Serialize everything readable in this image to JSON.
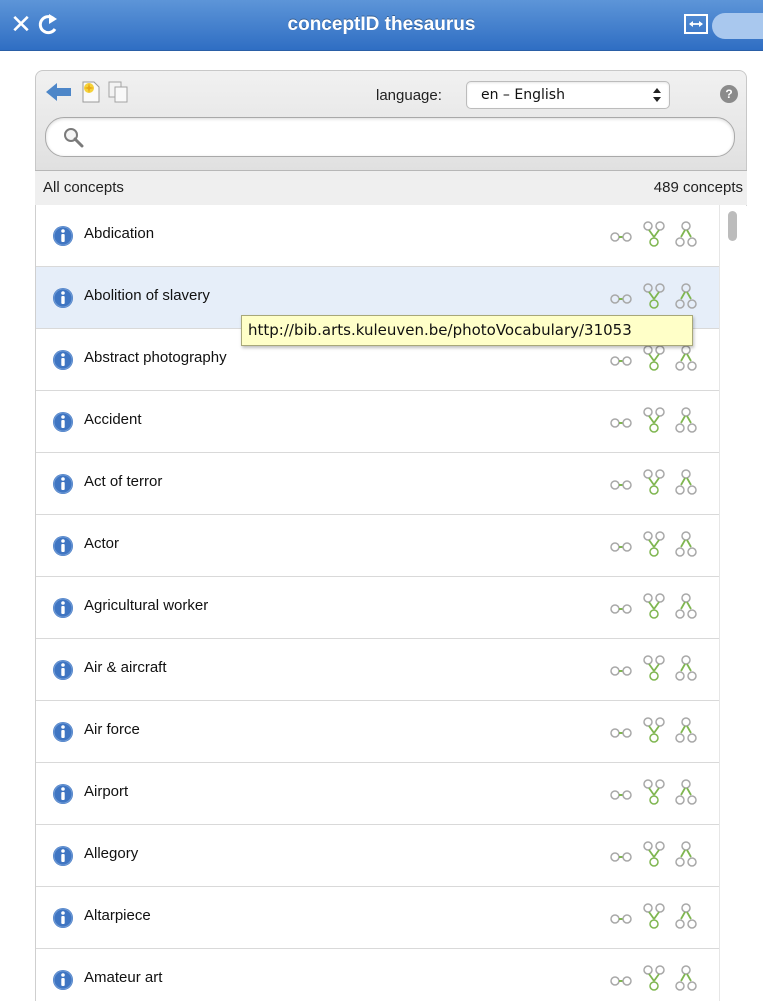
{
  "window": {
    "title": "conceptID thesaurus"
  },
  "toolbar": {
    "language_label": "language:",
    "language_value": "en – English"
  },
  "search": {
    "value": "",
    "placeholder": ""
  },
  "list_header": {
    "left": "All concepts",
    "count": "489 concepts"
  },
  "tooltip": {
    "text": "http://bib.arts.kuleuven.be/photoVocabulary/31053"
  },
  "concepts": [
    {
      "label": "Abdication"
    },
    {
      "label": "Abolition of slavery"
    },
    {
      "label": "Abstract photography"
    },
    {
      "label": "Accident"
    },
    {
      "label": "Act of terror"
    },
    {
      "label": "Actor"
    },
    {
      "label": "Agricultural worker"
    },
    {
      "label": "Air & aircraft"
    },
    {
      "label": "Air force"
    },
    {
      "label": "Airport"
    },
    {
      "label": "Allegory"
    },
    {
      "label": "Altarpiece"
    },
    {
      "label": "Amateur art"
    }
  ],
  "selected_index": 1,
  "colors": {
    "titlebar": "#3f7fcf",
    "selected_row": "#e6eef9",
    "icon_green": "#7fb650",
    "info_blue": "#3f75c2"
  },
  "icons": {
    "close": "close-icon",
    "refresh": "refresh-icon",
    "expand": "expand-icon",
    "back": "back-arrow-icon",
    "new": "new-concept-icon",
    "copy": "copy-icon",
    "help": "help-icon",
    "search": "search-icon",
    "info": "info-icon",
    "related": "related-icon",
    "narrower": "narrower-icon",
    "hierarchy": "hierarchy-icon"
  }
}
